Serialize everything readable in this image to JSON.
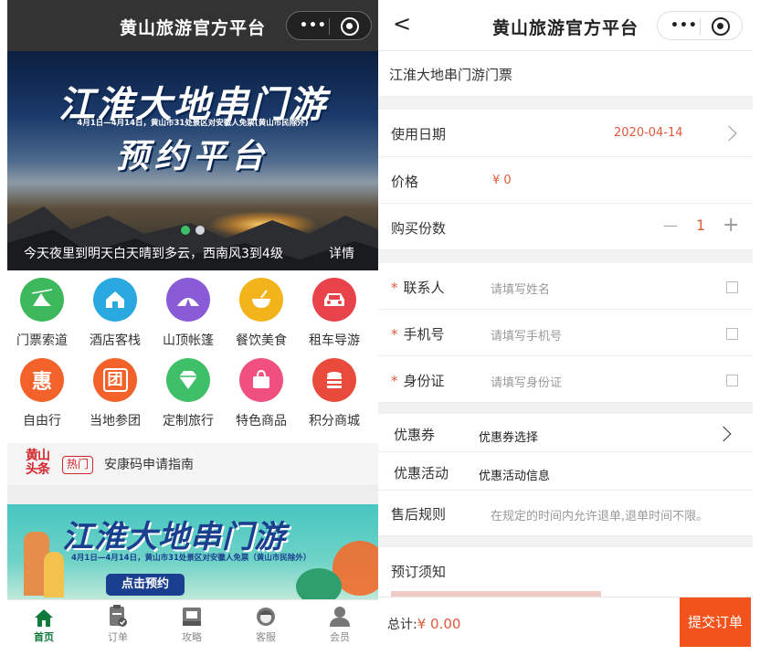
{
  "left": {
    "title": "黄山旅游官方平台",
    "capsule_dots": "•••",
    "banner": {
      "title": "江淮大地串门游",
      "subtitle": "4月1日—4月14日，黄山市31处景区对安徽人免票(黄山市民除外)",
      "title2": "预约平台",
      "weather": "今天夜里到明天白天晴到多云，西南风3到4级",
      "detail": "详情",
      "active_slide": 1,
      "slide_count": 2
    },
    "grid": [
      {
        "label": "门票索道",
        "icon": "ticket-cableway-icon",
        "color": "#3db85c"
      },
      {
        "label": "酒店客栈",
        "icon": "hotel-icon",
        "color": "#2aa8e0"
      },
      {
        "label": "山顶帐篷",
        "icon": "tent-icon",
        "color": "#8a5bd6"
      },
      {
        "label": "餐饮美食",
        "icon": "food-icon",
        "color": "#f2b31b"
      },
      {
        "label": "租车导游",
        "icon": "car-icon",
        "color": "#e8434b"
      },
      {
        "label": "自由行",
        "icon": "hui-icon",
        "glyph": "惠",
        "color": "#f2622a"
      },
      {
        "label": "当地参团",
        "icon": "tuan-icon",
        "glyph": "团",
        "color": "#f2622a"
      },
      {
        "label": "定制旅行",
        "icon": "diamond-icon",
        "color": "#3fbf67"
      },
      {
        "label": "特色商品",
        "icon": "shopping-bag-icon",
        "color": "#f0507f"
      },
      {
        "label": "积分商城",
        "icon": "coins-icon",
        "color": "#e84a3c"
      }
    ],
    "headline": {
      "logo": "黄山头条",
      "hot": "热门",
      "text": "安康码申请指南"
    },
    "banner2": {
      "title": "江淮大地串门游",
      "subtitle": "4月1日—4月14日，黄山市31处景区对安徽人免票（黄山市民除外）",
      "button": "点击预约"
    },
    "tabs": [
      {
        "label": "首页",
        "icon": "home-icon",
        "active": true
      },
      {
        "label": "订单",
        "icon": "order-icon",
        "active": false
      },
      {
        "label": "攻略",
        "icon": "guide-icon",
        "active": false
      },
      {
        "label": "客服",
        "icon": "service-icon",
        "active": false
      },
      {
        "label": "会员",
        "icon": "member-icon",
        "active": false
      }
    ]
  },
  "right": {
    "title": "黄山旅游官方平台",
    "back": "<",
    "capsule_dots": "•••",
    "product": "江淮大地串门游门票",
    "date_label": "使用日期",
    "date_value": "2020-04-14",
    "price_label": "价格",
    "price_value": "¥ 0",
    "qty_label": "购买份数",
    "qty_minus": "—",
    "qty_value": "1",
    "qty_plus": "+",
    "star": "*",
    "contact_label": "联系人",
    "contact_placeholder": "请填写姓名",
    "phone_label": "手机号",
    "phone_placeholder": "请填写手机号",
    "id_label": "身份证",
    "id_placeholder": "请填写身份证",
    "coupon_label": "优惠券",
    "coupon_value": "优惠券选择",
    "promo_label": "优惠活动",
    "promo_value": "优惠活动信息",
    "rules_label": "售后规则",
    "rules_value": "在规定的时间内允许退单,退单时间不限。",
    "notice_label": "预订须知",
    "total_label": "总计:",
    "total_value": "¥ 0.00",
    "submit": "提交订单",
    "accent": "#e05a3a",
    "submit_color": "#f2531d"
  }
}
